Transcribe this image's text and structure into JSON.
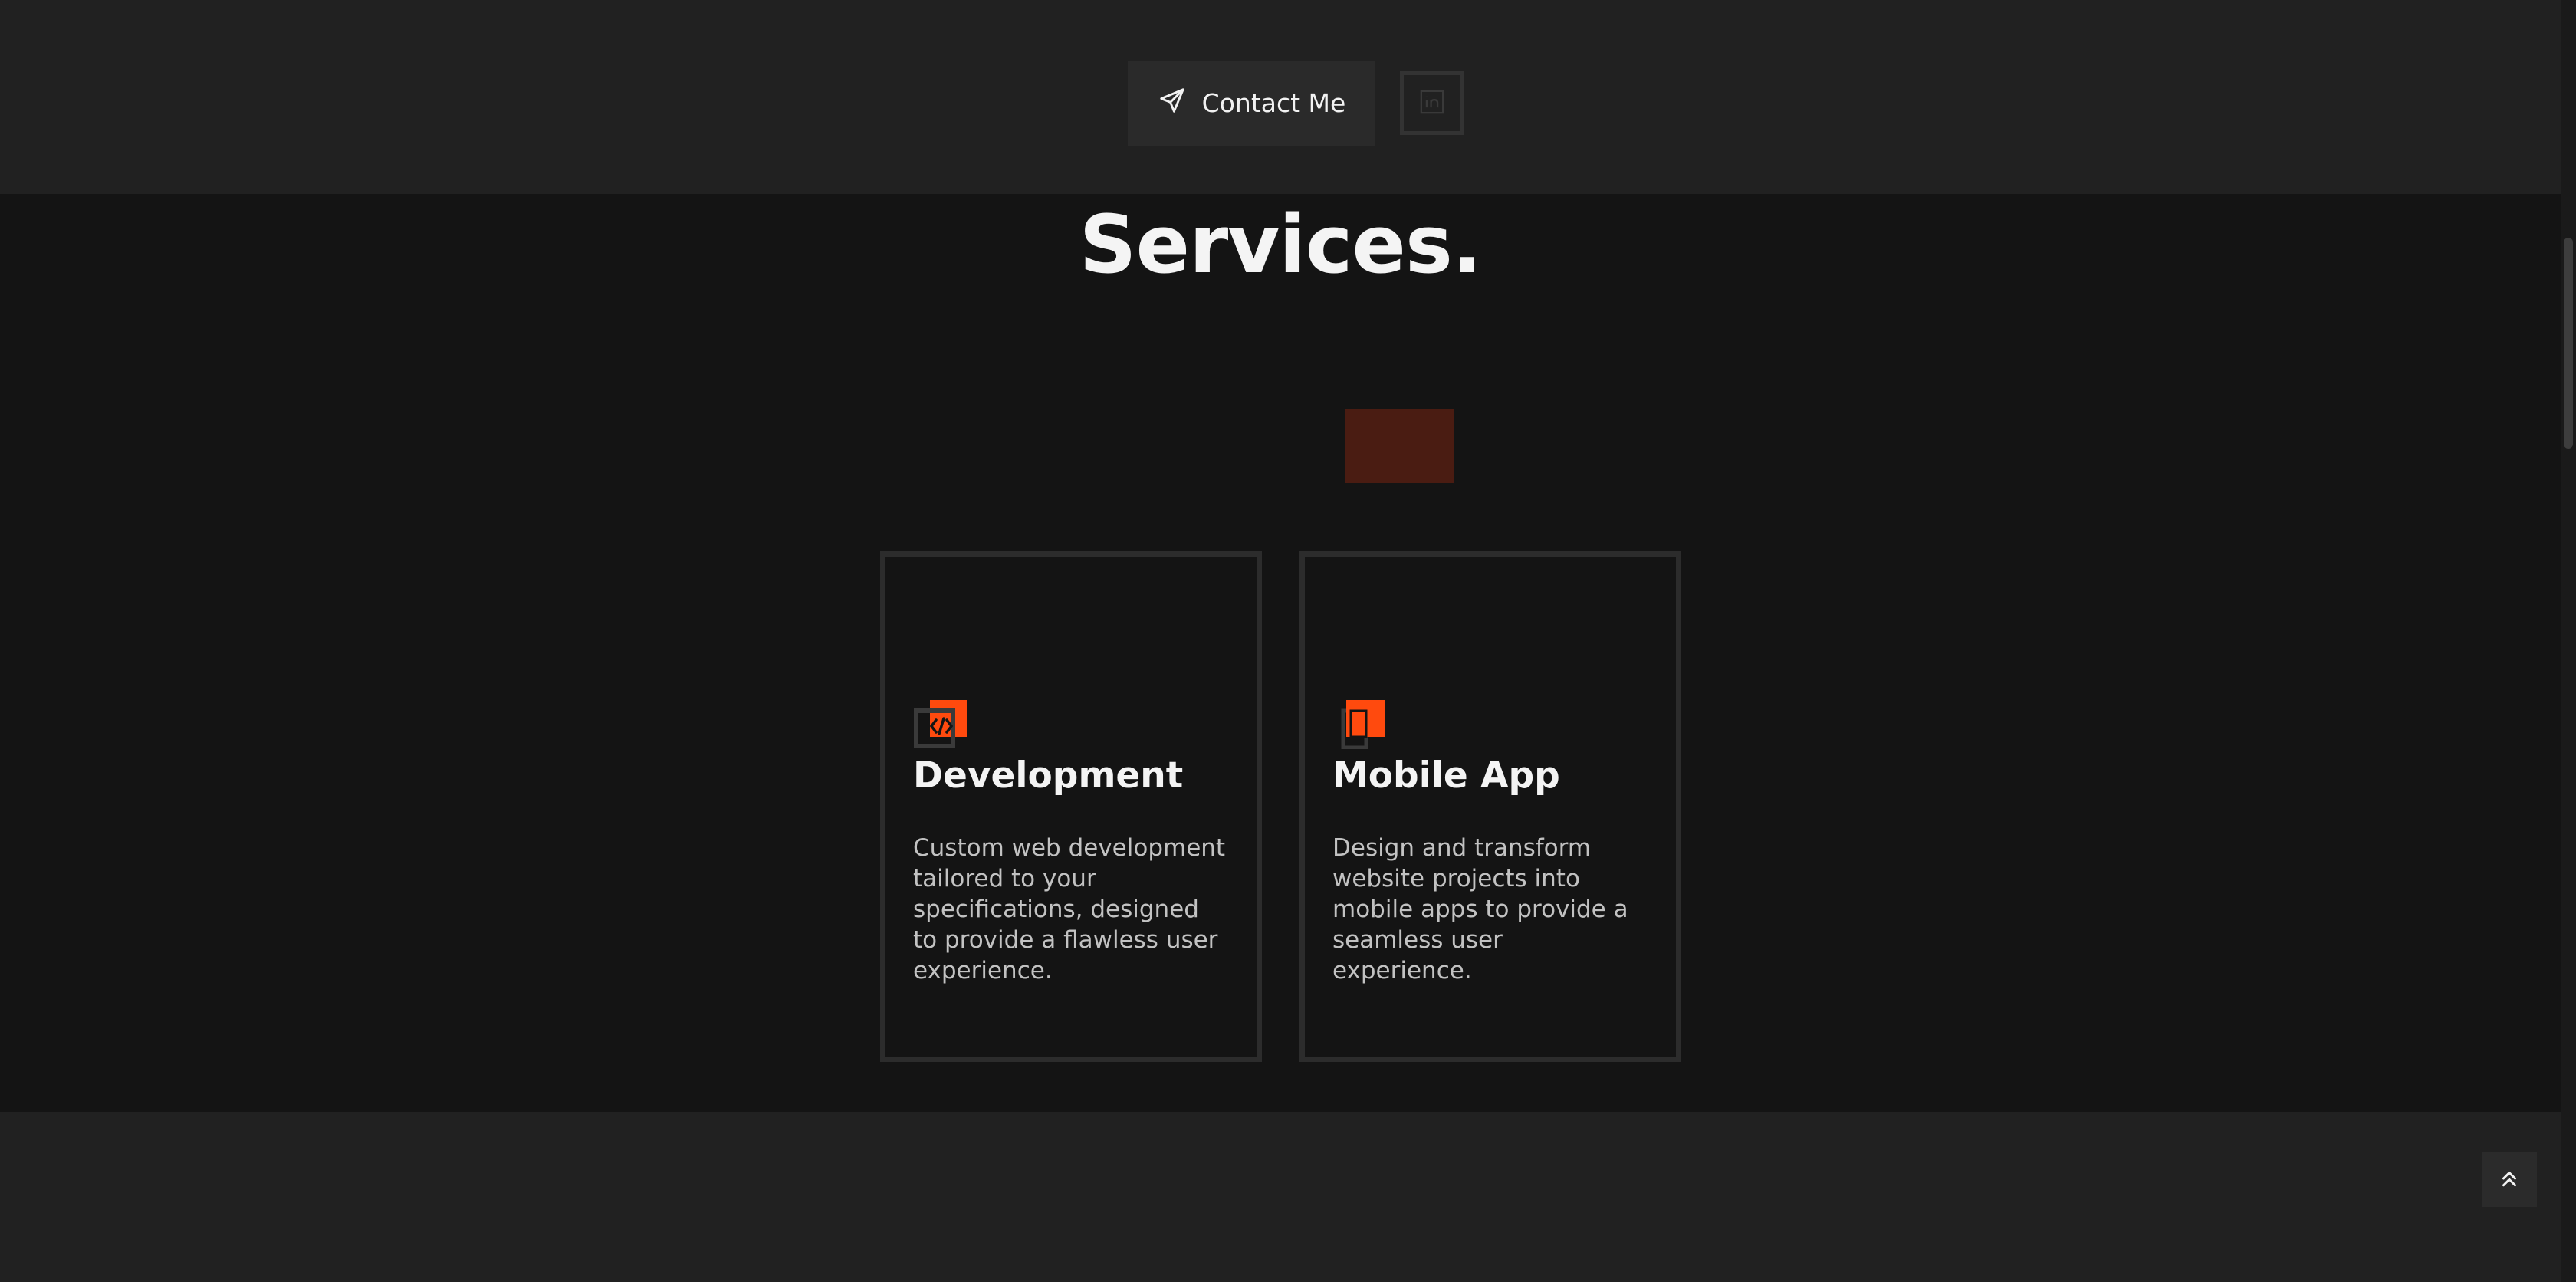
{
  "hero": {
    "contact_label": "Contact Me",
    "contact_icon": "send-icon",
    "linkedin_icon": "linkedin-icon"
  },
  "services": {
    "title": "Services.",
    "cards": [
      {
        "title": "Development",
        "description": "Custom web development tailored to your specifications, designed to provide a flawless user experience.",
        "icon": "code-icon"
      },
      {
        "title": "Mobile App",
        "description": "Design and transform website projects into mobile apps to provide a seamless user experience.",
        "icon": "mobile-icon"
      }
    ]
  },
  "back_to_top": {
    "icon": "double-chevron-up-icon"
  },
  "colors": {
    "accent": "#ff4a0e",
    "background": "#141414",
    "band": "#212121",
    "highlight": "#4a1c12",
    "card_border": "#2c2c2c"
  }
}
